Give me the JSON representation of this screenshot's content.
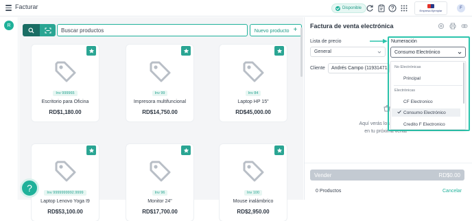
{
  "topbar": {
    "app_title": "Facturar",
    "status_badge": "Disponible",
    "company_logo_text": "Empresa Ejemplar",
    "user_initial": "F"
  },
  "sidebar": {
    "user_initial": "R",
    "help_icon": "?"
  },
  "search": {
    "placeholder": "Buscar productos",
    "new_product_label": "Nuevo producto"
  },
  "products": [
    {
      "ref": "Inv 999965",
      "name": "Escritorio para Oficina",
      "price": "RD$1,180.00"
    },
    {
      "ref": "Inv 99",
      "name": "Impresora multifuncional",
      "price": "RD$14,750.00"
    },
    {
      "ref": "Inv 84",
      "name": "Laptop HP 15\"",
      "price": "RD$45,000.00"
    },
    {
      "ref": "Inv 9999999992.9999",
      "name": "Laptop Lenovo Yoga I9",
      "price": "RD$53,100.00"
    },
    {
      "ref": "Inv 96",
      "name": "Monitor 24\"",
      "price": "RD$17,700.00"
    },
    {
      "ref": "Inv 100",
      "name": "Mouse inalámbrico",
      "price": "RD$2,950.00"
    }
  ],
  "panel": {
    "title": "Factura de venta electrónica",
    "price_list_label": "Lista de precio",
    "price_list_value": "General",
    "numeration_label": "Numeración",
    "numeration_value": "Consumo Electrónico",
    "client_label": "Cliente",
    "client_value": "Andrés Campo (11931471",
    "empty_line1": "Aquí verás los productos",
    "empty_line2": "en tu próxima venta",
    "sell_label": "Vender",
    "sell_total": "RD$0.00",
    "products_count": "0 Productos",
    "cancel_label": "Cancelar"
  },
  "dropdown": {
    "group1": "No Electrónicas",
    "group1_items": [
      "Principal"
    ],
    "group2": "Electrónicas",
    "group2_items": [
      "CF Electronico",
      "Consumo Electrónico",
      "Credito F Electronico"
    ],
    "selected": "Consumo Electrónico"
  },
  "colors": {
    "accent": "#1fb19a",
    "dark_accent": "#1a6d64",
    "highlight": "#2bc4ac"
  }
}
